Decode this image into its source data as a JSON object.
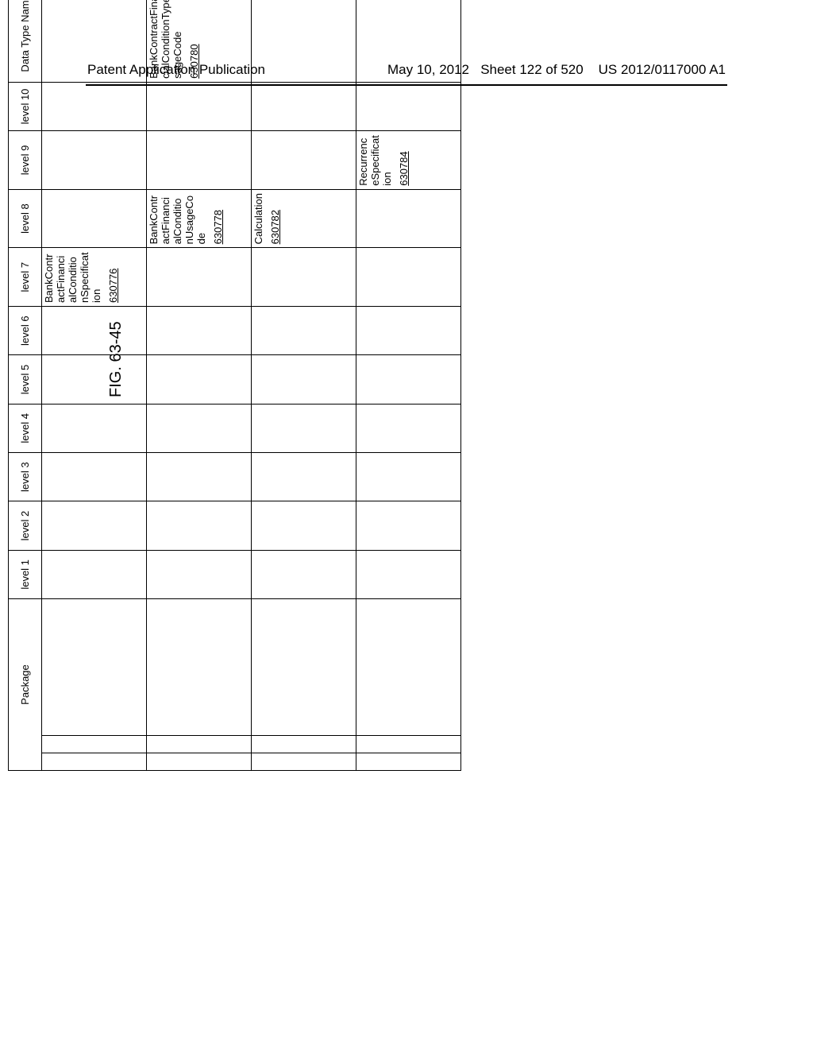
{
  "header": {
    "left": "Patent Application Publication",
    "right_date": "May 10, 2012",
    "right_sheet": "Sheet 122 of 520",
    "right_pub": "US 2012/0117000 A1"
  },
  "figure_label": "FIG. 63-45",
  "columns": {
    "package": "Package",
    "level1": "level 1",
    "level2": "level 2",
    "level3": "level 3",
    "level4": "level 4",
    "level5": "level 5",
    "level6": "level 6",
    "level7": "level 7",
    "level8": "level 8",
    "level9": "level 9",
    "level10": "level 10",
    "data_type_name": "Data Type Name"
  },
  "rows": [
    {
      "level7": {
        "text": "BankContractFinancialConditionSpecification",
        "ref": "630776"
      }
    },
    {
      "level8": {
        "text": "BankContractFinancialConditionUsageCode",
        "ref": "630778"
      },
      "data_type_name": {
        "text": "BankContractFinancialConditionTypeUsageCode",
        "ref": "630780"
      }
    },
    {
      "level8": {
        "text": "Calculation",
        "ref": "630782"
      }
    },
    {
      "level9": {
        "text": "RecurrenceSpecification",
        "ref": "630784"
      }
    }
  ]
}
